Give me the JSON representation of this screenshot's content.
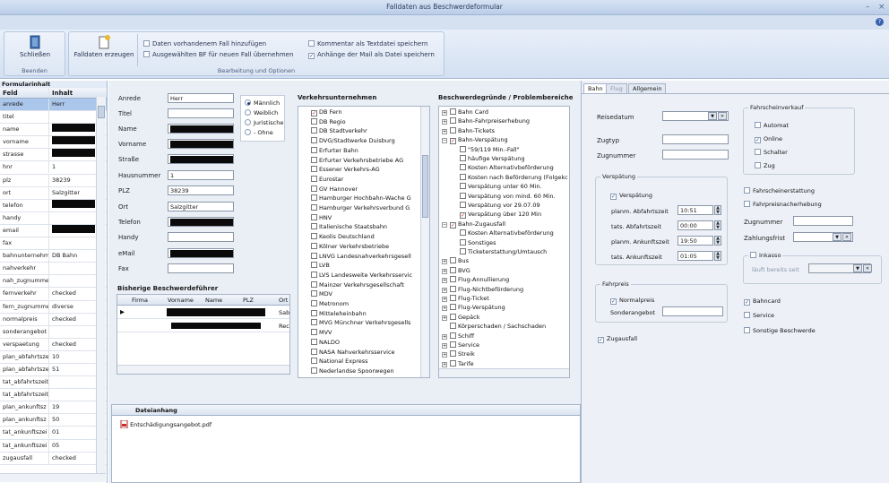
{
  "window": {
    "title": "Falldaten aus Beschwerdeformular"
  },
  "ribbon": {
    "close_label": "Schließen",
    "generate_label": "Falldaten erzeugen",
    "group_end_label": "Beenden",
    "group_edit_label": "Bearbeitung und Optionen",
    "options": [
      {
        "label": "Daten vorhandenem Fall hinzufügen",
        "checked": false
      },
      {
        "label": "Ausgewählten BF für neuen Fall übernehmen",
        "checked": false
      },
      {
        "label": "Kommentar als Textdatei speichern",
        "checked": false
      },
      {
        "label": "Anhänge der Mail als Datei speichern",
        "checked": true
      }
    ]
  },
  "formdata": {
    "title": "Formularinhalt",
    "col_field": "Feld",
    "col_value": "Inhalt",
    "rows": [
      {
        "field": "anrede",
        "value": "Herr",
        "redacted": false
      },
      {
        "field": "titel",
        "value": "",
        "redacted": false
      },
      {
        "field": "name",
        "value": "",
        "redacted": true
      },
      {
        "field": "vorname",
        "value": "",
        "redacted": true
      },
      {
        "field": "strasse",
        "value": "",
        "redacted": true
      },
      {
        "field": "hnr",
        "value": "1",
        "redacted": false
      },
      {
        "field": "plz",
        "value": "38239",
        "redacted": false
      },
      {
        "field": "ort",
        "value": "Salzgitter",
        "redacted": false
      },
      {
        "field": "telefon",
        "value": "",
        "redacted": true
      },
      {
        "field": "handy",
        "value": "",
        "redacted": false
      },
      {
        "field": "email",
        "value": "",
        "redacted": true
      },
      {
        "field": "fax",
        "value": "",
        "redacted": false
      },
      {
        "field": "bahnunternehm",
        "value": "DB Bahn",
        "redacted": false
      },
      {
        "field": "nahverkehr",
        "value": "",
        "redacted": false
      },
      {
        "field": "nah_zugnumme",
        "value": "",
        "redacted": false
      },
      {
        "field": "fernverkehr",
        "value": "checked",
        "redacted": false
      },
      {
        "field": "fern_zugnumme",
        "value": "diverse",
        "redacted": false
      },
      {
        "field": "normalpreis",
        "value": "checked",
        "redacted": false
      },
      {
        "field": "sonderangebot",
        "value": "",
        "redacted": false
      },
      {
        "field": "verspaetung",
        "value": "checked",
        "redacted": false
      },
      {
        "field": "plan_abfahrtsze",
        "value": "10",
        "redacted": false
      },
      {
        "field": "plan_abfahrtsze",
        "value": "51",
        "redacted": false
      },
      {
        "field": "tat_abfahrtszeit",
        "value": "",
        "redacted": false
      },
      {
        "field": "tat_abfahrtszeit",
        "value": "",
        "redacted": false
      },
      {
        "field": "plan_ankunftsz",
        "value": "19",
        "redacted": false
      },
      {
        "field": "plan_ankunftsz",
        "value": "50",
        "redacted": false
      },
      {
        "field": "tat_ankunftszei",
        "value": "01",
        "redacted": false
      },
      {
        "field": "tat_ankunftszei",
        "value": "05",
        "redacted": false
      },
      {
        "field": "zugausfall",
        "value": "checked",
        "redacted": false
      }
    ]
  },
  "person": {
    "anrede_label": "Anrede",
    "anrede_value": "Herr",
    "titel_label": "Titel",
    "name_label": "Name",
    "vorname_label": "Vorname",
    "strasse_label": "Straße",
    "hnr_label": "Hausnummer",
    "hnr_value": "1",
    "plz_label": "PLZ",
    "plz_value": "38239",
    "ort_label": "Ort",
    "ort_value": "Salzgitter",
    "telefon_label": "Telefon",
    "handy_label": "Handy",
    "email_label": "eMail",
    "fax_label": "Fax",
    "gender": [
      {
        "label": "Männlich",
        "selected": true
      },
      {
        "label": "Weiblich",
        "selected": false
      },
      {
        "label": "Juristische",
        "selected": false
      },
      {
        "label": "- Ohne",
        "selected": false
      }
    ]
  },
  "previous": {
    "title": "Bisherige Beschwerdeführer",
    "columns": [
      "Firma",
      "Vorname",
      "Name",
      "PLZ",
      "Ort"
    ],
    "row1_ort": "Sab",
    "row2_ort": "Rec"
  },
  "companies": {
    "title": "Verkehrsunternehmen",
    "items": [
      {
        "label": "DB Fern",
        "checked": true
      },
      {
        "label": "DB Regio",
        "checked": false
      },
      {
        "label": "DB Stadtverkehr",
        "checked": false
      },
      {
        "label": "DVG/Stadtwerke Duisburg",
        "checked": false
      },
      {
        "label": "Erfurter Bahn",
        "checked": false
      },
      {
        "label": "Erfurter Verkehrsbetriebe AG",
        "checked": false
      },
      {
        "label": "Essener Verkehrs-AG",
        "checked": false
      },
      {
        "label": "Eurostar",
        "checked": false
      },
      {
        "label": "GV Hannover",
        "checked": false
      },
      {
        "label": "Hamburger Hochbahn-Wache G",
        "checked": false
      },
      {
        "label": "Hamburger Verkehrsverbund G",
        "checked": false
      },
      {
        "label": "HNV",
        "checked": false
      },
      {
        "label": "Italienische Staatsbahn",
        "checked": false
      },
      {
        "label": "Keolis Deutschland",
        "checked": false
      },
      {
        "label": "Kölner Verkehrsbetriebe",
        "checked": false
      },
      {
        "label": "LNVG Landesnahverkehrsgesell",
        "checked": false
      },
      {
        "label": "LVB",
        "checked": false
      },
      {
        "label": "LVS Landesweite Verkehrsservic",
        "checked": false
      },
      {
        "label": "Mainzer Verkehrsgesellschaft",
        "checked": false
      },
      {
        "label": "MDV",
        "checked": false
      },
      {
        "label": "Metronom",
        "checked": false
      },
      {
        "label": "Mitteleheinbahn",
        "checked": false
      },
      {
        "label": "MVG Münchner Verkehrsgesells",
        "checked": false
      },
      {
        "label": "MVV",
        "checked": false
      },
      {
        "label": "NALDO",
        "checked": false
      },
      {
        "label": "NASA Nahverkehrsservice",
        "checked": false
      },
      {
        "label": "National Express",
        "checked": false
      },
      {
        "label": "Nederlandse Spoorwegen",
        "checked": false
      }
    ]
  },
  "reasons": {
    "title": "Beschwerdegründe / Problembereiche",
    "items": [
      {
        "label": "Bahn Card",
        "level": 0,
        "exp": "+",
        "checked": false
      },
      {
        "label": "Bahn-Fahrpreiserhebung",
        "level": 0,
        "exp": "+",
        "checked": false
      },
      {
        "label": "Bahn-Tickets",
        "level": 0,
        "exp": "+",
        "checked": false
      },
      {
        "label": "Bahn-Verspätung",
        "level": 0,
        "exp": "-",
        "checked": true
      },
      {
        "label": "\"59/119 Min.-Fall\"",
        "level": 1,
        "exp": "",
        "checked": false
      },
      {
        "label": "häufige Verspätung",
        "level": 1,
        "exp": "",
        "checked": false
      },
      {
        "label": "Kosten Alternativbeförderung",
        "level": 1,
        "exp": "",
        "checked": false
      },
      {
        "label": "Kosten nach Beförderung (Folgekc",
        "level": 1,
        "exp": "",
        "checked": false
      },
      {
        "label": "Verspätung unter 60 Min.",
        "level": 1,
        "exp": "",
        "checked": false
      },
      {
        "label": "Verspätung von mind. 60 Min.",
        "level": 1,
        "exp": "",
        "checked": false
      },
      {
        "label": "Verspätung vor 29.07.09",
        "level": 1,
        "exp": "",
        "checked": false
      },
      {
        "label": "Verspätung über 120 Min",
        "level": 1,
        "exp": "",
        "checked": true
      },
      {
        "label": "Bahn-Zugausfall",
        "level": 0,
        "exp": "-",
        "checked": true
      },
      {
        "label": "Kosten Alternativbeförderung",
        "level": 1,
        "exp": "",
        "checked": false
      },
      {
        "label": "Sonstiges",
        "level": 1,
        "exp": "",
        "checked": false
      },
      {
        "label": "Ticketerstattung/Umtausch",
        "level": 1,
        "exp": "",
        "checked": false
      },
      {
        "label": "Bus",
        "level": 0,
        "exp": "+",
        "checked": false
      },
      {
        "label": "BVG",
        "level": 0,
        "exp": "+",
        "checked": false
      },
      {
        "label": "Flug-Annullierung",
        "level": 0,
        "exp": "+",
        "checked": false
      },
      {
        "label": "Flug-Nichtbeförderung",
        "level": 0,
        "exp": "+",
        "checked": false
      },
      {
        "label": "Flug-Ticket",
        "level": 0,
        "exp": "+",
        "checked": false
      },
      {
        "label": "Flug-Verspätung",
        "level": 0,
        "exp": "+",
        "checked": false
      },
      {
        "label": "Gepäck",
        "level": 0,
        "exp": "+",
        "checked": false
      },
      {
        "label": "Körperschaden / Sachschaden",
        "level": 0,
        "exp": "",
        "checked": false
      },
      {
        "label": "Schiff",
        "level": 0,
        "exp": "+",
        "checked": false
      },
      {
        "label": "Service",
        "level": 0,
        "exp": "+",
        "checked": false
      },
      {
        "label": "Streik",
        "level": 0,
        "exp": "+",
        "checked": false
      },
      {
        "label": "Tarife",
        "level": 0,
        "exp": "+",
        "checked": false
      }
    ]
  },
  "attachment": {
    "title": "Dateianhang",
    "file": "Entschädigungsangebot.pdf"
  },
  "right": {
    "tabs": [
      "Bahn",
      "Flug",
      "Allgemein"
    ],
    "reisedatum_label": "Reisedatum",
    "zugtyp_label": "Zugtyp",
    "zugnummer_label": "Zugnummer",
    "verspaetung_legend": "Verspätung",
    "verspaetung_check": "Verspätung",
    "planm_abfahrt_label": "planm. Abfahrtszeit",
    "planm_abfahrt_value": "10:51",
    "tats_abfahrt_label": "tats. Abfahrtszeit",
    "tats_abfahrt_value": "00:00",
    "planm_ankunft_label": "planm. Ankunftszeit",
    "planm_ankunft_value": "19:50",
    "tats_ankunft_label": "tats. Ankunftszeit",
    "tats_ankunft_value": "01:05",
    "fahrpreis_legend": "Fahrpreis",
    "normalpreis_label": "Normalpreis",
    "sonderangebot_label": "Sonderangebot",
    "zugausfall_label": "Zugausfall",
    "fahrscheinverkauf_legend": "Fahrscheinverkauf",
    "sales": [
      {
        "label": "Automat",
        "checked": false
      },
      {
        "label": "Online",
        "checked": true
      },
      {
        "label": "Schalter",
        "checked": false
      },
      {
        "label": "Zug",
        "checked": false
      }
    ],
    "fahrscheinerstattung_label": "Fahrscheinerstattung",
    "fahrpreisnacherhebung_label": "Fahrpreisnacherhebung",
    "zugnummer2_label": "Zugnummer",
    "zahlungsfrist_label": "Zahlungsfrist",
    "inkasso_label": "Inkasso",
    "laeuft_label": "läuft bereits seit",
    "bahncard_label": "Bahncard",
    "service_label": "Service",
    "sonstige_label": "Sonstige Beschwerde"
  }
}
